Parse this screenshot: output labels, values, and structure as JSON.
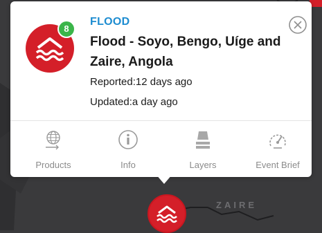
{
  "event": {
    "category": "FLOOD",
    "title": "Flood - Soyo, Bengo, Uíge and Zaire, Angola",
    "reported": "Reported:12 days ago",
    "updated": "Updated:a day ago",
    "count_badge": "8",
    "icon": "flood-icon"
  },
  "actions": [
    {
      "label": "Products",
      "icon": "globe-products-icon"
    },
    {
      "label": "Info",
      "icon": "info-icon"
    },
    {
      "label": "Layers",
      "icon": "layers-icon"
    },
    {
      "label": "Event Brief",
      "icon": "gauge-icon"
    }
  ],
  "map": {
    "region_label": "ZAIRE"
  },
  "colors": {
    "hazard_red": "#d41f29",
    "badge_green": "#3bb54a",
    "category_blue": "#1d8cd0",
    "action_gray": "#8b8b8b",
    "map_bg": "#3a3a3c"
  }
}
